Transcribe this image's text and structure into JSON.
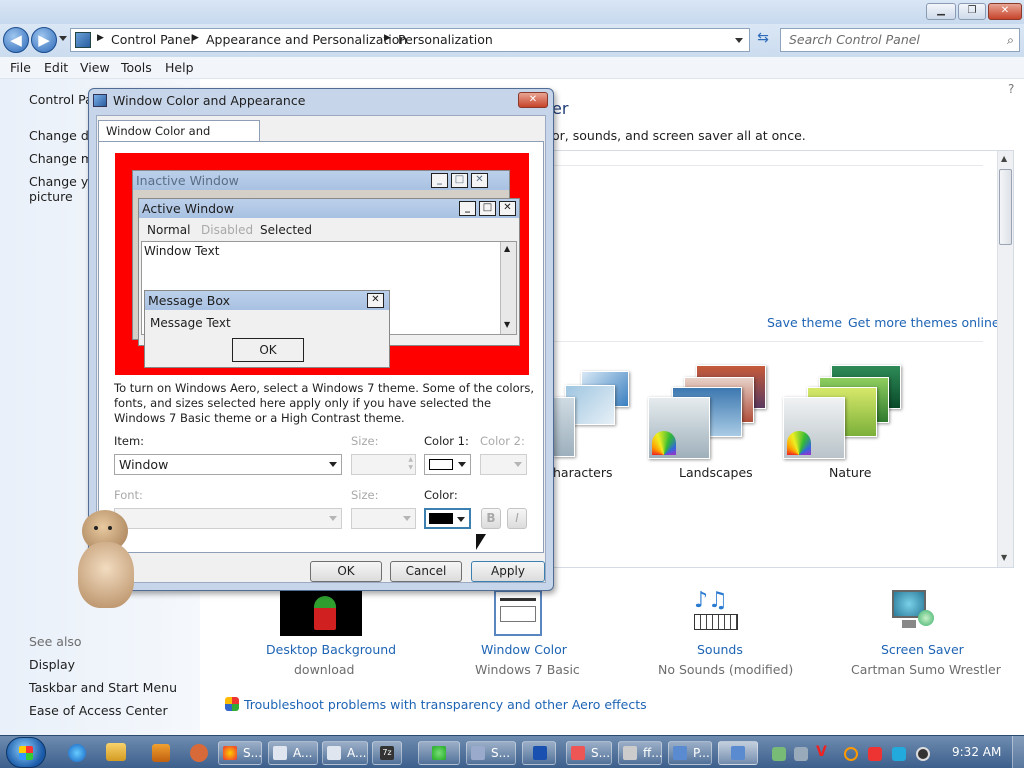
{
  "window": {
    "minimize": "▁",
    "maximize": "❐",
    "close": "✕"
  },
  "nav": {
    "back": "◀",
    "forward": "▶",
    "breadcrumb": [
      "Control Panel",
      "Appearance and Personalization",
      "Personalization"
    ],
    "search_placeholder": "Search Control Panel"
  },
  "menu": [
    "File",
    "Edit",
    "View",
    "Tools",
    "Help"
  ],
  "left_pane": {
    "home": "Control Panel Home",
    "links": [
      "Change desktop icons",
      "Change mouse pointers",
      "Change your account picture"
    ],
    "see_also_header": "See also",
    "see_also": [
      "Display",
      "Taskbar and Start Menu",
      "Ease of Access Center"
    ]
  },
  "content": {
    "heading_tail": "er",
    "description_tail": "or, sounds, and screen saver all at once.",
    "save_theme": "Save theme",
    "get_more_themes": "Get more themes online",
    "themes": [
      "haracters",
      "Landscapes",
      "Nature"
    ],
    "bottom": [
      {
        "title": "Desktop Background",
        "sub": "download"
      },
      {
        "title": "Window Color",
        "sub": "Windows 7 Basic"
      },
      {
        "title": "Sounds",
        "sub": "No Sounds (modified)"
      },
      {
        "title": "Screen Saver",
        "sub": "Cartman Sumo Wrestler"
      }
    ],
    "troubleshoot": "Troubleshoot problems with transparency and other Aero effects"
  },
  "dialog": {
    "title": "Window Color and Appearance",
    "tab": "Window Color and Appearance",
    "preview": {
      "inactive_window": "Inactive Window",
      "active_window": "Active Window",
      "menu_normal": "Normal",
      "menu_disabled": "Disabled",
      "menu_selected": "Selected",
      "window_text": "Window Text",
      "message_box": "Message Box",
      "message_text": "Message Text",
      "ok": "OK"
    },
    "info": "To turn on Windows Aero, select a Windows 7 theme.  Some of the colors, fonts, and sizes selected here apply only if you have selected the Windows 7 Basic theme or a High Contrast theme.",
    "item_label": "Item:",
    "item_value": "Window",
    "size_label": "Size:",
    "color1_label": "Color 1:",
    "color2_label": "Color 2:",
    "font_label": "Font:",
    "font_size_label": "Size:",
    "color_label": "Color:",
    "bold": "B",
    "italic": "I",
    "ok": "OK",
    "cancel": "Cancel",
    "apply": "Apply",
    "color1_value": "#ffffff",
    "color_value": "#000000",
    "preview_bg": "#ff0000"
  },
  "taskbar": {
    "buttons": [
      "S...",
      "A...",
      "A...",
      "S...",
      "S...",
      "ff...",
      "P..."
    ],
    "clock": "9:32 AM"
  }
}
